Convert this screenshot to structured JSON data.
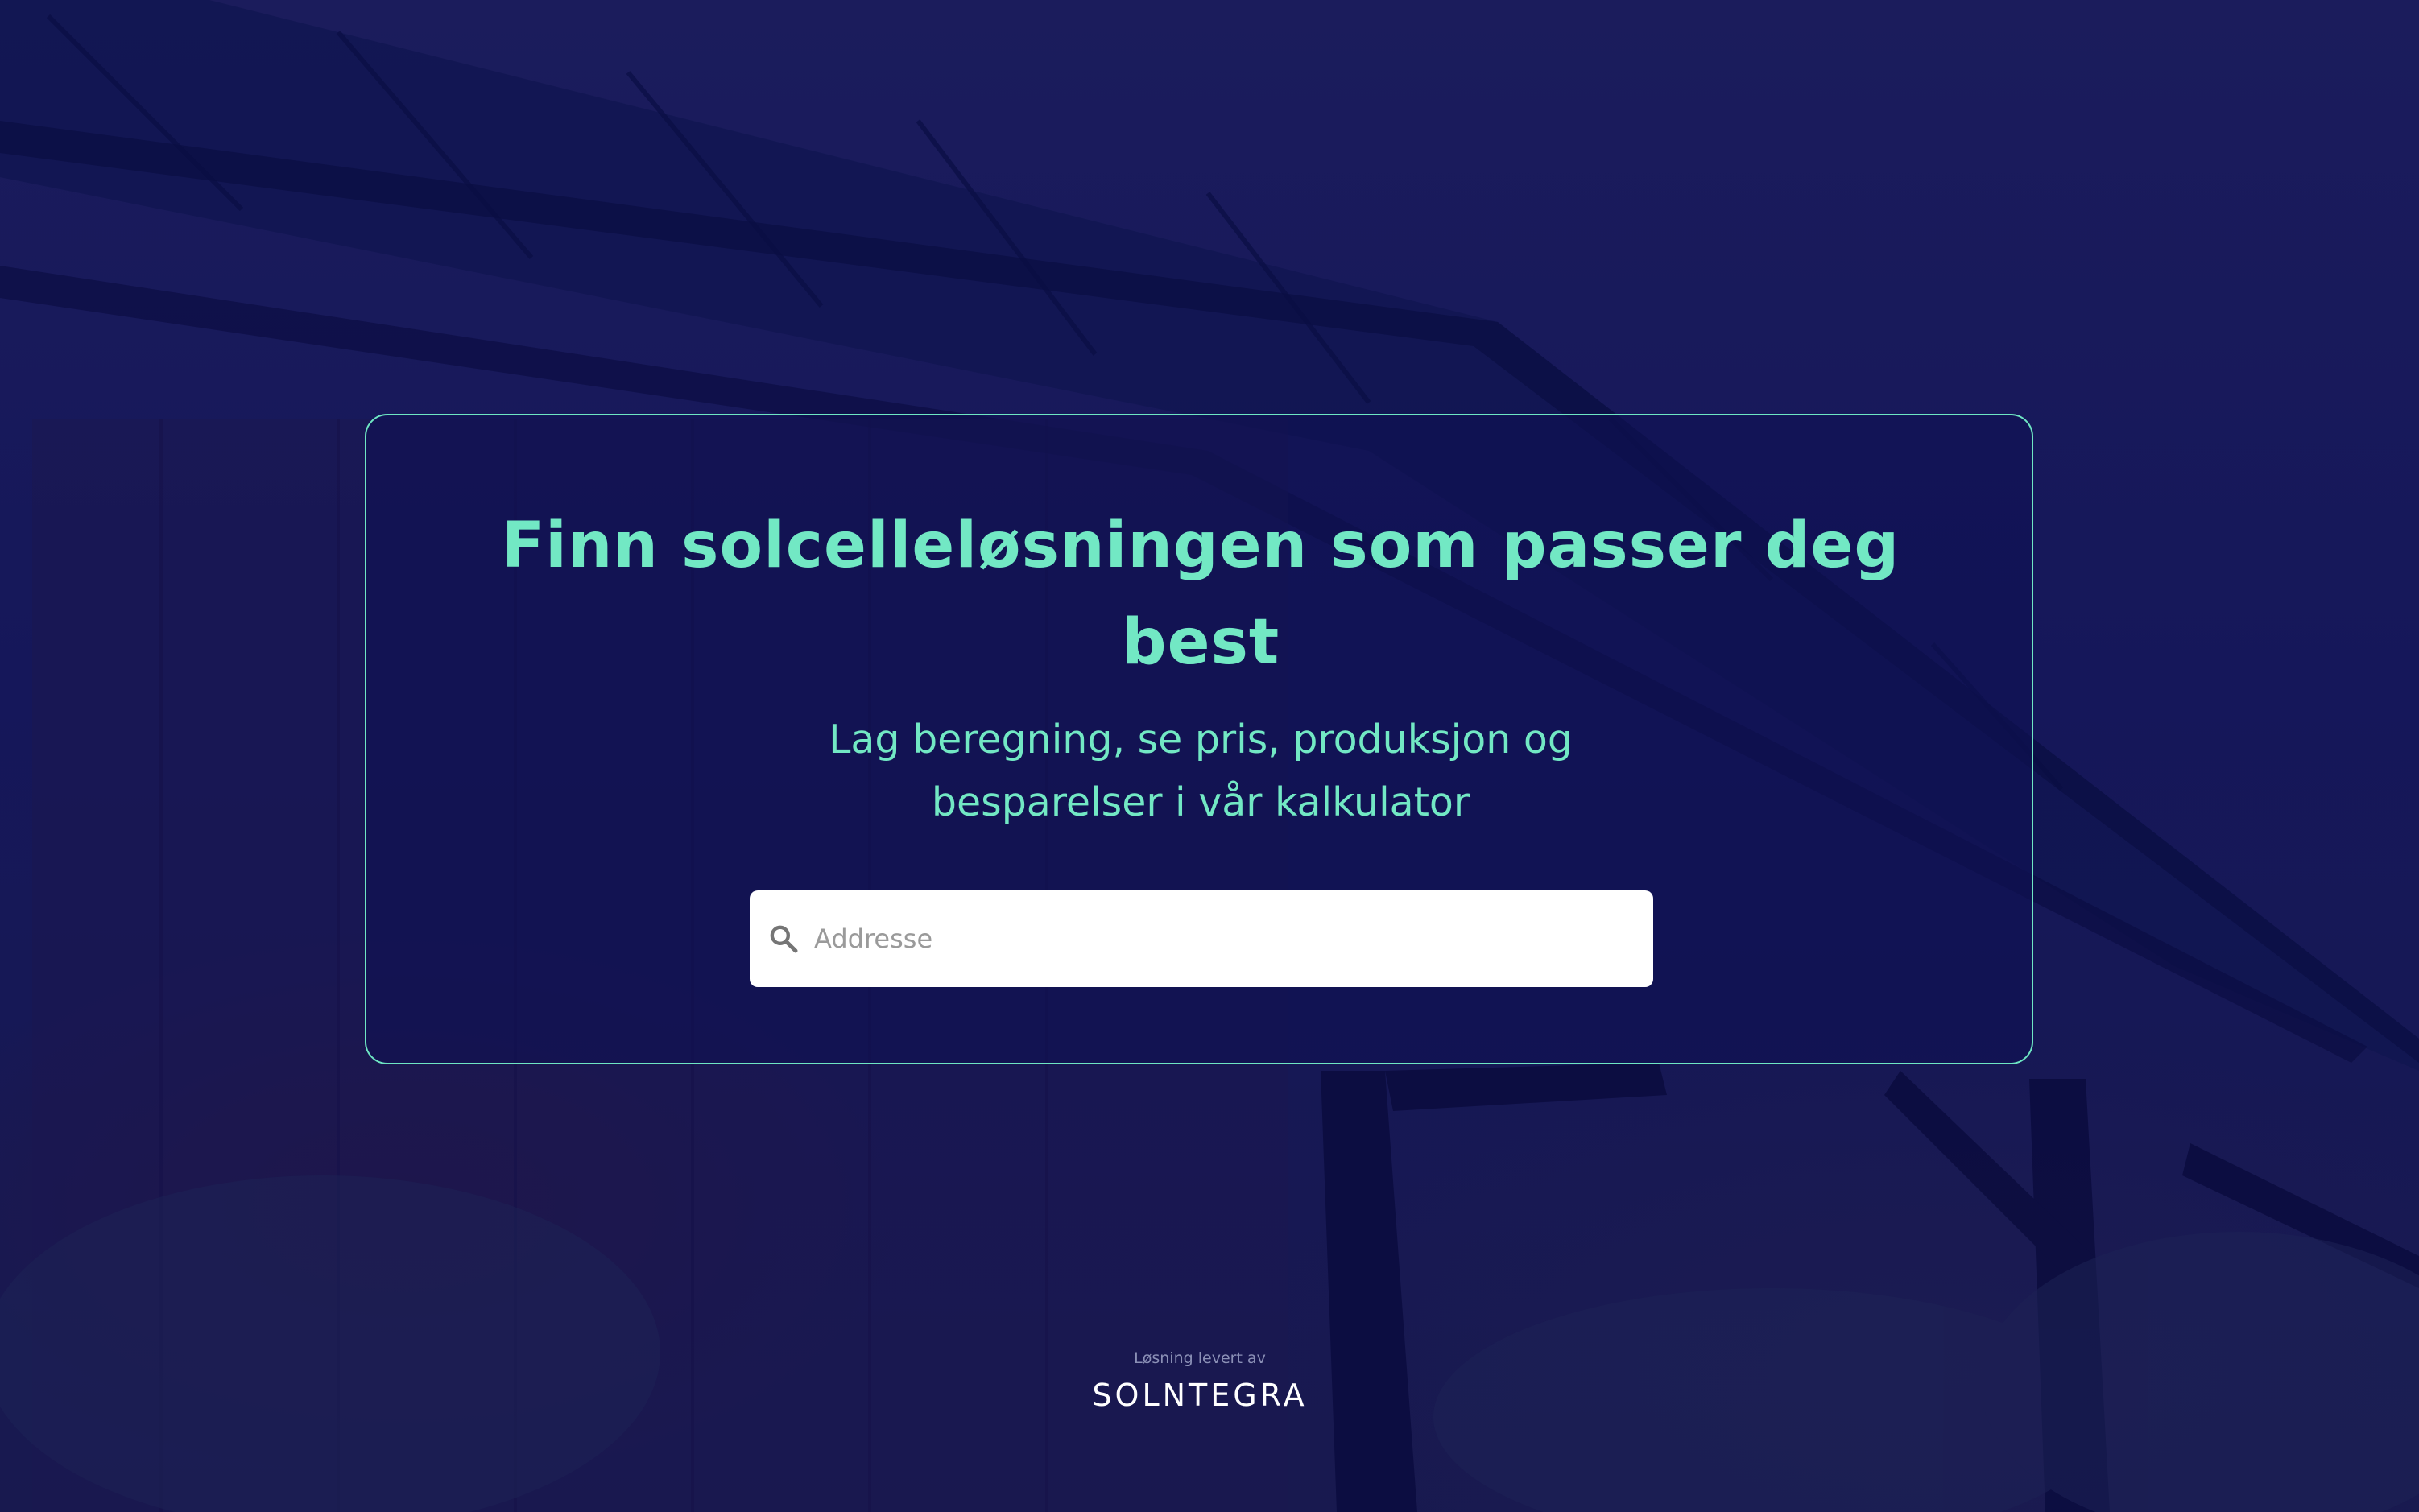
{
  "hero": {
    "title_line1": "Finn solcelleløsningen som passer deg",
    "title_line2": "best",
    "subtitle_line1": "Lag beregning, se pris, produksjon og",
    "subtitle_line2": "besparelser i vår kalkulator"
  },
  "search": {
    "placeholder": "Addresse",
    "value": "",
    "icon": "search-icon"
  },
  "footer": {
    "provided_by": "Løsning levert av",
    "brand": "SOLNTEGRA"
  },
  "colors": {
    "accent": "#72e8c4",
    "background": "#17185a",
    "card_border": "#6ee6c3",
    "input_background": "#ffffff",
    "placeholder": "#9a9a9a"
  }
}
